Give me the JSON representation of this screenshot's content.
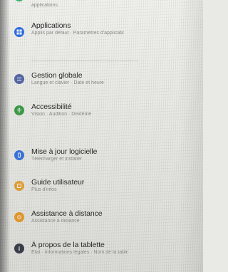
{
  "settings": {
    "items": [
      {
        "title": "",
        "subtitle": "applications",
        "color": "#3bb36b"
      },
      {
        "title": "Applications",
        "subtitle": "Applis par défaut · Paramètres d'application",
        "color": "#2f6fe0"
      },
      {
        "title": "Gestion globale",
        "subtitle": "Langue et clavier · Date et heure",
        "color": "#5668a6"
      },
      {
        "title": "Accessibilité",
        "subtitle": "Vision · Audition · Dextérité",
        "color": "#3f9d4a"
      },
      {
        "title": "Mise à jour logicielle",
        "subtitle": "Télécharger et installer",
        "color": "#3c74dc"
      },
      {
        "title": "Guide utilisateur",
        "subtitle": "Plus d'infos",
        "color": "#e2a23a"
      },
      {
        "title": "Assistance à distance",
        "subtitle": "Assistance à distance",
        "color": "#e39a2f"
      },
      {
        "title": "À propos de la tablette",
        "subtitle": "État · Informations légales · Nom de la tablette",
        "color": "#3b3f4b"
      }
    ]
  }
}
